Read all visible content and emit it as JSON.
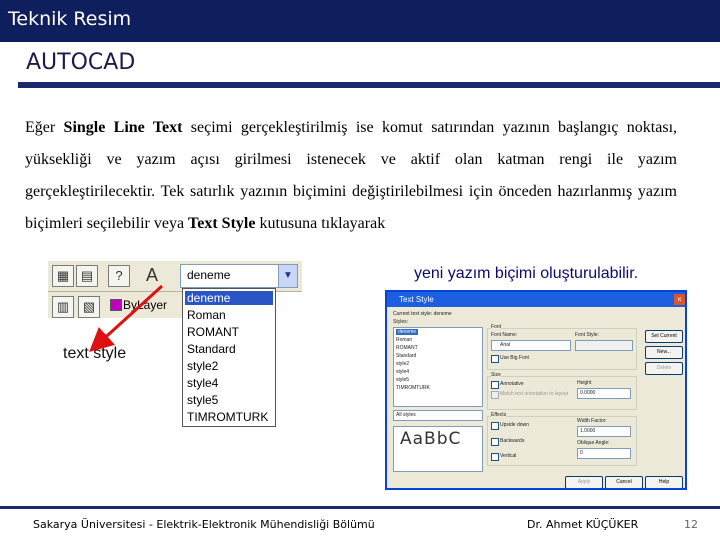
{
  "header": {
    "title": "Teknik Resim"
  },
  "section": {
    "title": "AUTOCAD"
  },
  "body": {
    "p1": "Eğer ",
    "p2": "Single Line Text",
    "p3": " seçimi gerçekleştirilmiş ise komut satırından yazının başlangıç noktası, yüksekliği ve yazım açısı girilmesi istenecek ve aktif olan katman rengi ile yazım gerçekleştirilecektir. Tek satırlık yazının biçimini değiştirilebilmesi için önceden hazırlanmış yazım biçimleri seçilebilir veya ",
    "p4": "Text Style",
    "p5": " kutusuna tıklayarak"
  },
  "caption_right": "yeni yazım biçimi oluşturulabilir.",
  "callout": "text style",
  "toolbar": {
    "dropdown_value": "deneme",
    "layer_label": "ByLayer",
    "list_items": [
      "deneme",
      "Roman",
      "ROMANT",
      "Standard",
      "style2",
      "style4",
      "style5",
      "TIMROMTURK"
    ],
    "selected_index": 0
  },
  "dialog": {
    "title": "Text Style",
    "current_style": "Current text style: deneme",
    "styles_label": "Styles:",
    "styles": [
      "deneme",
      "Roman",
      "ROMANT",
      "Standard",
      "style2",
      "style4",
      "style5",
      "TIMROMTURK"
    ],
    "filter_value": "All styles",
    "font_group": "Font",
    "font_name_label": "Font Name:",
    "font_name_value": "Arial",
    "font_style_label": "Font Style:",
    "big_font_label": "Use Big Font",
    "size_group": "Size",
    "annotative_label": "Annotative",
    "match_label": "Match text orientation to layout",
    "height_label": "Height",
    "height_value": "0.0000",
    "effects_group": "Effects",
    "upside_down_label": "Upside down",
    "backwards_label": "Backwards",
    "vertical_label": "Vertical",
    "width_factor_label": "Width Factor:",
    "width_factor_value": "1.0000",
    "oblique_label": "Oblique Angle:",
    "oblique_value": "0",
    "preview_text": "AaBbC",
    "btn_set_current": "Set Current",
    "btn_new": "New...",
    "btn_delete": "Delete",
    "btn_apply": "Apply",
    "btn_cancel": "Cancel",
    "btn_help": "Help"
  },
  "footer": {
    "left": "Sakarya Üniversitesi - Elektrik-Elektronik Mühendisliği Bölümü",
    "author": "Dr. Ahmet KÜÇÜKER",
    "page": "12"
  },
  "colors": {
    "header_bg": "#0f1f5e",
    "rule": "#1a2a6c",
    "arrow": "#e01010",
    "caption": "#0a0a6e",
    "list_selected": "#2a55c5"
  }
}
